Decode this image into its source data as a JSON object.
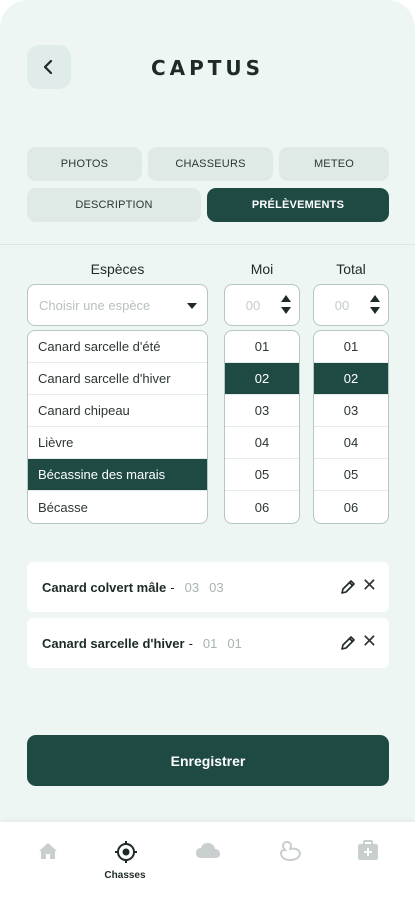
{
  "header": {
    "title": "CAPTUS"
  },
  "tabs": [
    {
      "label": "PHOTOS",
      "active": false
    },
    {
      "label": "CHASSEURS",
      "active": false
    },
    {
      "label": "METEO",
      "active": false
    },
    {
      "label": "DESCRIPTION",
      "active": false
    },
    {
      "label": "PRÉLÈVEMENTS",
      "active": true
    }
  ],
  "form": {
    "species_label": "Espèces",
    "month_label": "Moi",
    "total_label": "Total",
    "species_placeholder": "Choisir une espèce",
    "month_placeholder": "00",
    "total_placeholder": "00",
    "species_options": [
      {
        "label": "Canard sarcelle d'été",
        "selected": false
      },
      {
        "label": "Canard sarcelle d'hiver",
        "selected": false
      },
      {
        "label": "Canard chipeau",
        "selected": false
      },
      {
        "label": "Lièvre",
        "selected": false
      },
      {
        "label": "Bécassine des marais",
        "selected": true
      },
      {
        "label": "Bécasse",
        "selected": false
      }
    ],
    "month_options": [
      "01",
      "02",
      "03",
      "04",
      "05",
      "06"
    ],
    "month_selected": "02",
    "total_options": [
      "01",
      "02",
      "03",
      "04",
      "05",
      "06"
    ],
    "total_selected": "02"
  },
  "entries": [
    {
      "name": "Canard colvert mâle",
      "dash": "-",
      "month": "03",
      "total": "03"
    },
    {
      "name": "Canard sarcelle d'hiver",
      "dash": "-",
      "month": "01",
      "total": "01"
    }
  ],
  "save_label": "Enregistrer",
  "nav": {
    "items": [
      {
        "icon": "home-icon",
        "label": ""
      },
      {
        "icon": "target-icon",
        "label": "Chasses",
        "active": true
      },
      {
        "icon": "cloud-icon",
        "label": ""
      },
      {
        "icon": "duck-icon",
        "label": ""
      },
      {
        "icon": "medical-kit-icon",
        "label": ""
      }
    ]
  },
  "colors": {
    "accent": "#1f4a44",
    "background": "#eef6f4",
    "inactive_icon": "#c9cfce"
  }
}
